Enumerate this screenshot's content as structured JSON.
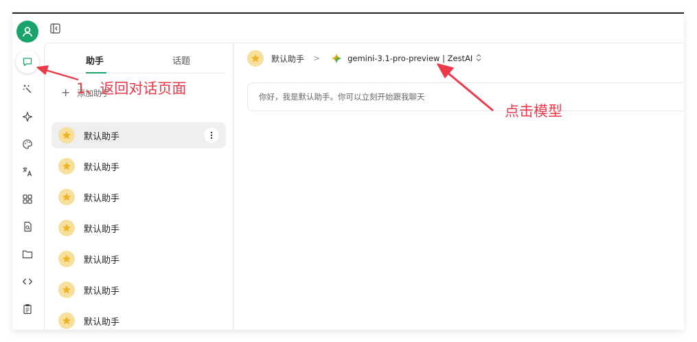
{
  "sidebar_rail": {
    "items": [
      "chat-icon",
      "sparkle-wand-icon",
      "star-sparkle-icon",
      "palette-icon",
      "translate-icon",
      "apps-grid-icon",
      "document-search-icon",
      "folder-icon",
      "code-icon",
      "clipboard-icon"
    ]
  },
  "assistants_panel": {
    "tabs": {
      "assistants": "助手",
      "topics": "话题"
    },
    "add_label": "添加助手",
    "items": [
      {
        "name": "默认助手"
      },
      {
        "name": "默认助手"
      },
      {
        "name": "默认助手"
      },
      {
        "name": "默认助手"
      },
      {
        "name": "默认助手"
      },
      {
        "name": "默认助手"
      },
      {
        "name": "默认助手"
      }
    ]
  },
  "chat_header": {
    "assistant_label": "默认助手",
    "separator": ">",
    "model_label": "gemini-3.1-pro-preview | ZestAI"
  },
  "welcome_message": "你好，我是默认助手。你可以立刻开始跟我聊天",
  "annotations": {
    "step1": "1、返回对话页面",
    "click_model": "点击模型"
  },
  "colors": {
    "accent": "#1aa36a",
    "annotation": "#ec3a4a",
    "assistant_avatar": "#f7df9e"
  }
}
